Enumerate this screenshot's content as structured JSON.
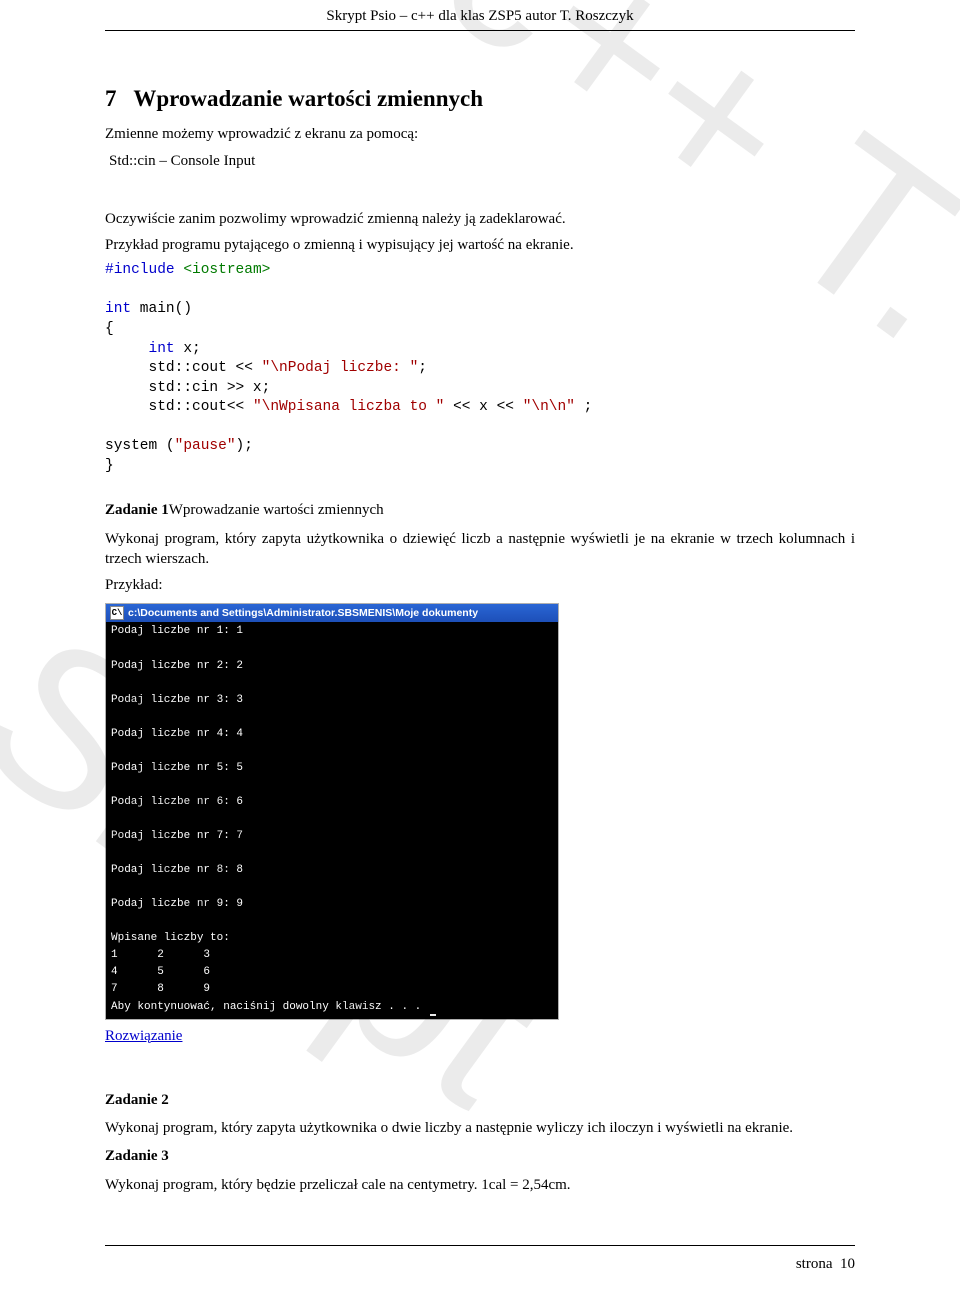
{
  "header": {
    "line": "Skrypt Psio – c++ dla klas ZSP5 autor T. Roszczyk"
  },
  "section": {
    "number": "7",
    "title": "Wprowadzanie wartości zmiennych",
    "intro1": "Zmienne możemy wprowadzić z ekranu za pomocą:",
    "intro2": "Std::cin – Console Input",
    "intro3": "Oczywiście zanim pozwolimy wprowadzić zmienną należy ją zadeklarować.",
    "intro4": "Przykład programu pytającego o zmienną i wypisujący jej wartość na ekranie."
  },
  "code": {
    "l1a": "#include",
    "l1b": " <iostream>",
    "l2a": "int",
    "l2b": " main()",
    "l3": "{",
    "l4a": "     int",
    "l4b": " x;",
    "l5a": "     std::cout << ",
    "l5b": "\"\\nPodaj liczbe: \"",
    "l5c": ";",
    "l6": "     std::cin >> x;",
    "l7a": "     std::cout<< ",
    "l7b": "\"\\nWpisana liczba to \"",
    "l7c": " << x << ",
    "l7d": "\"\\n\\n\"",
    "l7e": " ;",
    "l8a": "system (",
    "l8b": "\"pause\"",
    "l8c": ");",
    "l9": "}"
  },
  "zad1": {
    "title": "Zadanie 1",
    "title_suffix": "Wprowadzanie wartości zmiennych",
    "body": "Wykonaj program, który zapyta użytkownika o dziewięć liczb a następnie wyświetli je na ekranie w trzech kolumnach i trzech wierszach.",
    "example_label": "Przykład:"
  },
  "console": {
    "icon": "C\\",
    "title": "c:\\Documents and Settings\\Administrator.SBSMENIS\\Moje dokumenty",
    "lines": [
      "Podaj liczbe nr 1: 1",
      "Podaj liczbe nr 2: 2",
      "Podaj liczbe nr 3: 3",
      "Podaj liczbe nr 4: 4",
      "Podaj liczbe nr 5: 5",
      "Podaj liczbe nr 6: 6",
      "Podaj liczbe nr 7: 7",
      "Podaj liczbe nr 8: 8",
      "Podaj liczbe nr 9: 9",
      "Wpisane liczby to:",
      "1      2      3",
      "4      5      6",
      "7      8      9",
      "Aby kontynuować, naciśnij dowolny klawisz . . . "
    ]
  },
  "link": {
    "label": "Rozwiązanie"
  },
  "zad2": {
    "title": "Zadanie 2",
    "body": "Wykonaj program, który zapyta użytkownika o dwie liczby a następnie wyliczy ich iloczyn i wyświetli na ekranie."
  },
  "zad3": {
    "title": "Zadanie 3",
    "body": "Wykonaj program, który będzie przeliczał cale na centymetry. 1cal = 2,54cm."
  },
  "footer": {
    "label": "strona",
    "page": "10"
  },
  "watermark": {
    "wm1": "Skrypt",
    "wm2": "c++ T. Roszczyk"
  }
}
